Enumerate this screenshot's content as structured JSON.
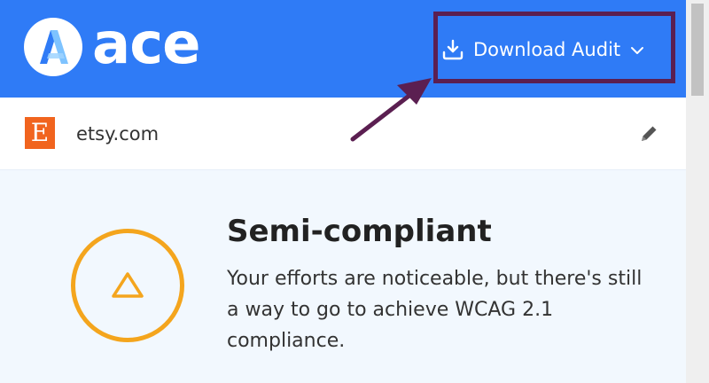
{
  "header": {
    "brand_name": "ace",
    "download_button": {
      "label": "Download Audit",
      "icon": "download-icon",
      "dropdown_icon": "chevron-down-icon"
    }
  },
  "site": {
    "favicon_letter": "E",
    "domain": "etsy.com",
    "edit_icon": "pencil-icon"
  },
  "compliance": {
    "status_icon": "warning-triangle-icon",
    "title": "Semi-compliant",
    "description": "Your efforts are noticeable, but there's still a way to go to achieve WCAG 2.1 compliance."
  },
  "colors": {
    "header_bg": "#2f7bf6",
    "favicon_bg": "#f1641e",
    "status_accent": "#f4a51d",
    "annotation": "#5b1f51",
    "status_area_bg": "#f2f8fe"
  }
}
